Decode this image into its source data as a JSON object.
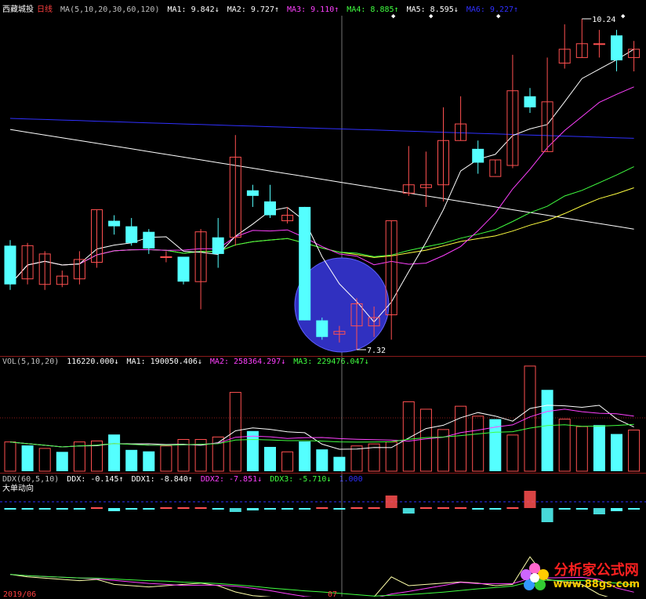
{
  "colors": {
    "up": "#ff5050",
    "down": "#54ffff",
    "ma1": "#ffffff",
    "ma2": "#ff40ff",
    "ma3": "#40ff40",
    "ma4": "#ffff40",
    "ma5": "#ffffff",
    "ma6": "#3030ff",
    "highlight_circle": "#3030c0",
    "crosshair": "#c0c0c0"
  },
  "price_legend": {
    "stock_name": "西藏城投",
    "period": "日线",
    "ma_params": "MA(5,10,20,30,60,120)",
    "ma1": "MA1: 9.842↓",
    "ma2": "MA2: 9.727↑",
    "ma3": "MA3: 9.110↑",
    "ma4": "MA4: 8.885↑",
    "ma5": "MA5: 8.595↓",
    "ma6": "MA6: 9.227↑"
  },
  "price_annotations": {
    "high": "10.24",
    "low": "7.32"
  },
  "vol_legend": {
    "params": "VOL(5,10,20)",
    "vol": "116220.000↓",
    "ma1": "MA1: 190050.406↓",
    "ma2": "MA2: 258364.297↓",
    "ma3": "MA3: 229476.047↓"
  },
  "ddx_legend": {
    "params": "DDX(60,5,10)",
    "ddx": "DDX: -0.145↑",
    "ddx1": "DDX1: -8.840↑",
    "ddx2": "DDX2: -7.851↓",
    "ddx3": "DDX3: -5.710↓",
    "extra": "1.000",
    "subtitle": "大单动向"
  },
  "axis_labels": {
    "month_left": "2019/06",
    "month_right": "07"
  },
  "watermark": {
    "title": "分析家公式网",
    "url": "www.88gs.com"
  },
  "candles": [
    [
      9.2,
      8.5,
      9.3,
      8.4
    ],
    [
      8.6,
      9.2,
      9.25,
      8.5
    ],
    [
      8.5,
      9.05,
      9.1,
      8.4
    ],
    [
      8.5,
      8.65,
      8.75,
      8.45
    ],
    [
      8.6,
      8.95,
      9.1,
      8.5
    ],
    [
      8.9,
      9.85,
      9.85,
      8.8
    ],
    [
      9.65,
      9.55,
      9.75,
      9.4
    ],
    [
      9.55,
      9.25,
      9.7,
      9.2
    ],
    [
      9.45,
      9.15,
      9.5,
      9.05
    ],
    [
      9.0,
      9.0,
      9.1,
      8.9
    ],
    [
      9.0,
      8.55,
      9.0,
      8.5
    ],
    [
      8.55,
      9.45,
      9.5,
      8.05
    ],
    [
      9.35,
      9.05,
      9.7,
      8.8
    ],
    [
      9.35,
      10.8,
      11.2,
      9.2
    ],
    [
      10.2,
      10.1,
      10.3,
      9.9
    ],
    [
      10.0,
      9.75,
      10.3,
      9.7
    ],
    [
      9.65,
      9.75,
      9.9,
      9.6
    ],
    [
      9.9,
      7.85,
      9.9,
      7.85
    ],
    [
      7.85,
      7.55,
      7.9,
      7.5
    ],
    [
      7.6,
      7.65,
      7.75,
      7.45
    ],
    [
      7.75,
      8.15,
      8.25,
      7.32
    ],
    [
      7.75,
      7.9,
      8.1,
      7.55
    ],
    [
      7.95,
      9.65,
      9.65,
      7.5
    ],
    [
      10.15,
      10.3,
      11.0,
      10.1
    ],
    [
      10.25,
      10.3,
      10.9,
      9.9
    ],
    [
      10.3,
      11.1,
      11.7,
      10.0
    ],
    [
      11.1,
      11.4,
      11.9,
      11.1
    ],
    [
      10.95,
      10.7,
      11.1,
      10.5
    ],
    [
      10.45,
      10.75,
      10.75,
      10.5
    ],
    [
      10.65,
      12.0,
      12.65,
      10.6
    ],
    [
      11.9,
      11.7,
      12.05,
      11.6
    ],
    [
      10.9,
      11.8,
      12.6,
      10.9
    ],
    [
      12.5,
      12.75,
      13.2,
      12.4
    ],
    [
      12.6,
      12.85,
      13.3,
      12.6
    ],
    [
      12.85,
      12.85,
      13.1,
      12.6
    ],
    [
      13.0,
      12.55,
      13.1,
      12.35
    ],
    [
      12.6,
      12.75,
      12.9,
      12.35
    ]
  ],
  "volumes": [
    [
      118000,
      1
    ],
    [
      104000,
      0
    ],
    [
      92000,
      1
    ],
    [
      78000,
      0
    ],
    [
      118000,
      1
    ],
    [
      122000,
      1
    ],
    [
      148000,
      0
    ],
    [
      86000,
      0
    ],
    [
      80000,
      0
    ],
    [
      102000,
      1
    ],
    [
      128000,
      1
    ],
    [
      128000,
      1
    ],
    [
      138000,
      1
    ],
    [
      318000,
      1
    ],
    [
      162000,
      0
    ],
    [
      98000,
      0
    ],
    [
      78000,
      1
    ],
    [
      120000,
      0
    ],
    [
      88000,
      0
    ],
    [
      58000,
      0
    ],
    [
      102000,
      1
    ],
    [
      110000,
      1
    ],
    [
      118000,
      1
    ],
    [
      280000,
      1
    ],
    [
      250000,
      1
    ],
    [
      168000,
      1
    ],
    [
      262000,
      1
    ],
    [
      222000,
      1
    ],
    [
      210000,
      0
    ],
    [
      146000,
      1
    ],
    [
      424000,
      1
    ],
    [
      328000,
      0
    ],
    [
      210000,
      1
    ],
    [
      180000,
      1
    ],
    [
      186000,
      0
    ],
    [
      150000,
      0
    ],
    [
      166000,
      1
    ]
  ],
  "ddx_bars": [
    -1,
    -2,
    -1,
    -1,
    -1,
    1,
    -4,
    -1,
    -1,
    1,
    1,
    1,
    -2,
    -5,
    -3,
    -1,
    -1,
    -1,
    1,
    -1,
    1,
    1,
    16,
    -7,
    1,
    1,
    1,
    -1,
    -2,
    1,
    22,
    -18,
    -2,
    -2,
    -8,
    -4,
    -1
  ]
}
